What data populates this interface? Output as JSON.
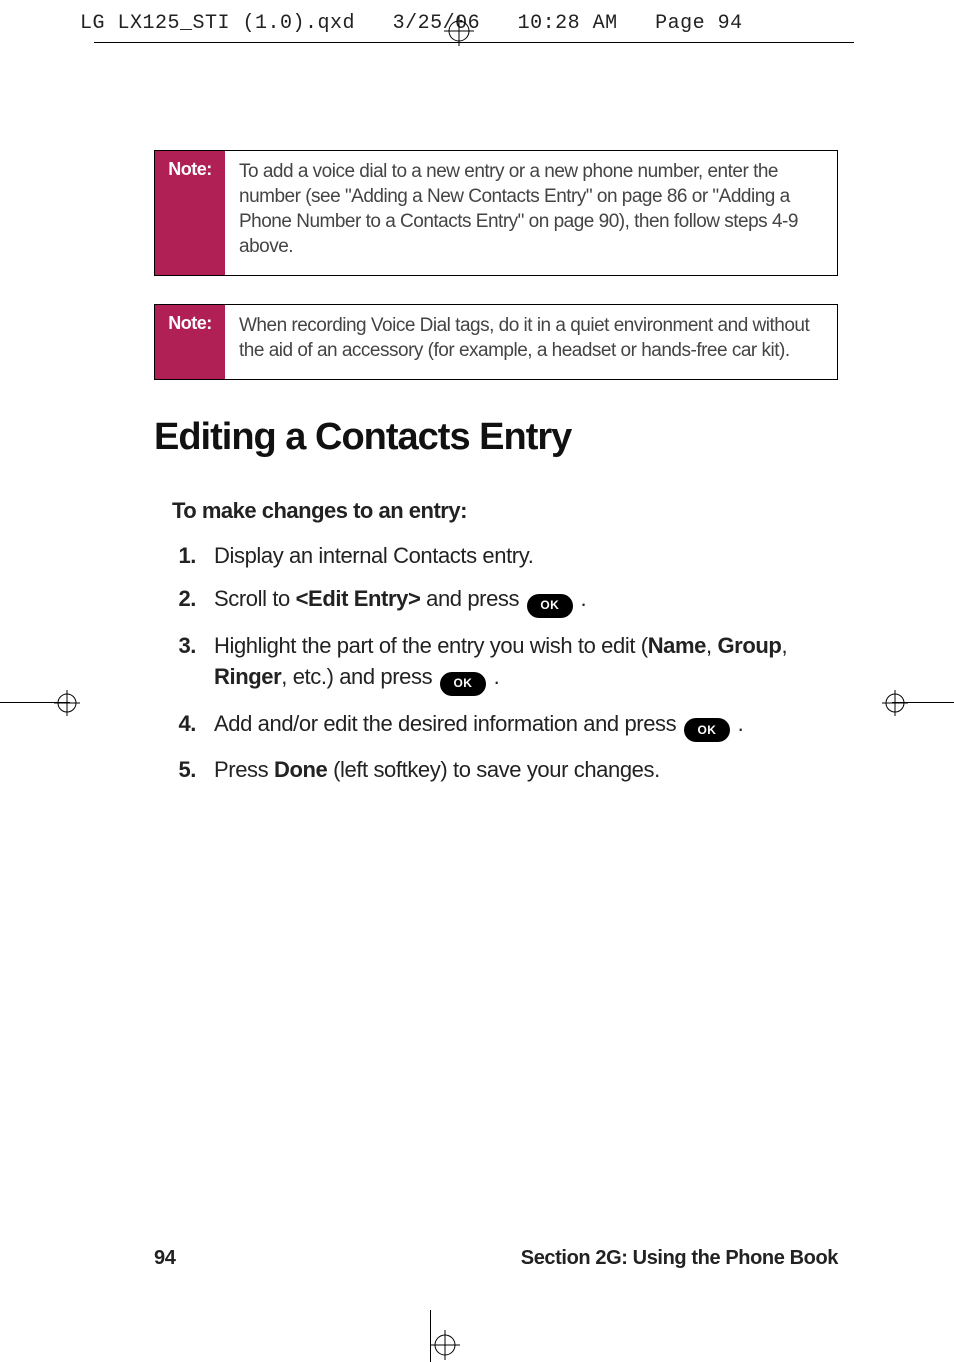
{
  "slug": {
    "file": "LG LX125_STI (1.0).qxd",
    "date": "3/25/06",
    "time": "10:28 AM",
    "page_label": "Page 94"
  },
  "notes": {
    "label": "Note:",
    "n1": "To add a voice dial to a new entry or a new phone number, enter the number (see \"Adding a New Contacts Entry\" on page 86 or \"Adding a Phone Number to a Contacts Entry\" on page 90), then follow steps 4-9 above.",
    "n2": "When recording Voice Dial tags, do it in a quiet environment and without the aid of an accessory (for example, a headset or hands-free car kit)."
  },
  "heading": "Editing a Contacts Entry",
  "instructions": {
    "lead": "To make changes to an entry:",
    "items": {
      "i1": {
        "num": "1.",
        "text": "Display an internal Contacts entry."
      },
      "i2": {
        "num": "2.",
        "pre": "Scroll to ",
        "bold": "<Edit Entry>",
        "mid": " and press ",
        "post": " ."
      },
      "i3": {
        "num": "3.",
        "pre": "Highlight the part of the entry you wish to edit (",
        "b1": "Name",
        "c1": ", ",
        "b2": "Group",
        "c2": ", ",
        "b3": "Ringer",
        "mid": ", etc.) and press ",
        "post": " ."
      },
      "i4": {
        "num": "4.",
        "pre": "Add and/or edit the desired information and press ",
        "post": " ."
      },
      "i5": {
        "num": "5.",
        "pre": "Press ",
        "bold": "Done",
        "post": " (left softkey) to save your changes."
      }
    }
  },
  "ok_label": "OK",
  "footer": {
    "page": "94",
    "section": "Section 2G: Using the Phone Book"
  }
}
